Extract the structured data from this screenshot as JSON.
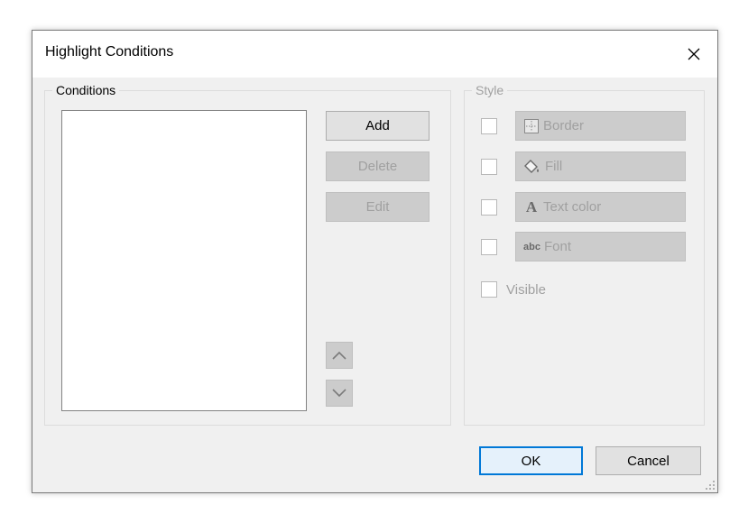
{
  "dialog": {
    "title": "Highlight Conditions"
  },
  "conditions": {
    "legend": "Conditions",
    "items": [],
    "buttons": {
      "add": "Add",
      "delete": "Delete",
      "edit": "Edit"
    }
  },
  "style": {
    "legend": "Style",
    "options": [
      {
        "label": "Border",
        "icon": "border-icon",
        "checked": false
      },
      {
        "label": "Fill",
        "icon": "paint-bucket-icon",
        "checked": false
      },
      {
        "label": "Text color",
        "icon": "text-color-icon",
        "icon_text": "A",
        "checked": false
      },
      {
        "label": "Font",
        "icon": "font-icon",
        "icon_text": "abc",
        "checked": false
      }
    ],
    "visible": {
      "label": "Visible",
      "checked": false
    }
  },
  "footer": {
    "ok": "OK",
    "cancel": "Cancel"
  },
  "colors": {
    "dialog_bg": "#f0f0f0",
    "disabled_text": "#a0a0a0",
    "accent": "#0078d7"
  }
}
